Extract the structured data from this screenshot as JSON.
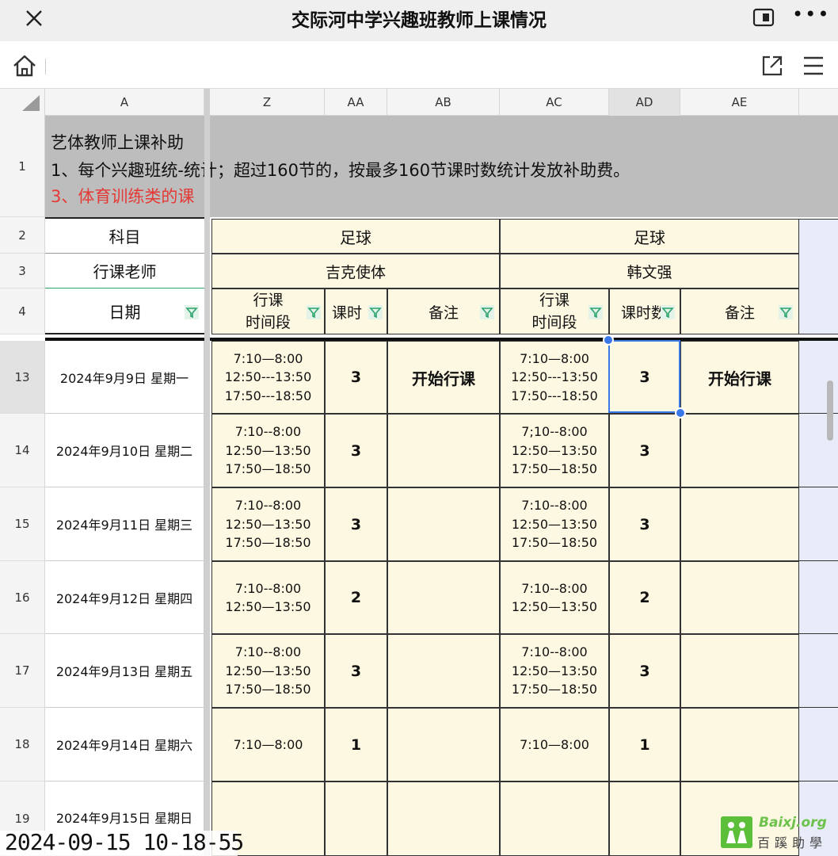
{
  "app": {
    "title": "交际河中学兴趣班教师上课情况"
  },
  "toolbar": {},
  "columns": [
    "A",
    "Z",
    "AA",
    "AB",
    "AC",
    "AD",
    "AE"
  ],
  "row_numbers": [
    "1",
    "2",
    "3",
    "4",
    "13",
    "14",
    "15",
    "16",
    "17",
    "18",
    "19"
  ],
  "notes": {
    "line1": "艺体教师上课补助",
    "line2": "1、每个兴趣班统-统计；超过160节的，按最多160节课时数统计发放补助费。",
    "line3": "3、体育训练类的课"
  },
  "headers": {
    "subject_label": "科目",
    "teacher_label": "行课老师",
    "date_label": "日期",
    "subject1": "足球",
    "subject2": "足球",
    "teacher1": "吉克使体",
    "teacher2": "韩文强",
    "period_label": "行课\n时间段",
    "hours_label": "课时",
    "hours_label_clipped": "课时数",
    "remark_label": "备注"
  },
  "rows": [
    {
      "date": "2024年9月9日 星期一",
      "time1": "7:10—8:00\n12:50---13:50\n17:50---18:50",
      "h1": "3",
      "n1": "开始行课",
      "time2": "7:10—8:00\n12:50---13:50\n17:50---18:50",
      "h2": "3",
      "n2": "开始行课"
    },
    {
      "date": "2024年9月10日 星期二",
      "time1": "7:10--8:00\n12:50—13:50\n17:50—18:50",
      "h1": "3",
      "n1": "",
      "time2": "7;10--8:00\n12:50—13:50\n17:50—18:50",
      "h2": "3",
      "n2": ""
    },
    {
      "date": "2024年9月11日 星期三",
      "time1": "7:10--8:00\n12:50—13:50\n17:50—18:50",
      "h1": "3",
      "n1": "",
      "time2": "7:10--8:00\n12:50—13:50\n17:50—18:50",
      "h2": "3",
      "n2": ""
    },
    {
      "date": "2024年9月12日 星期四",
      "time1": "7:10--8:00\n12:50—13:50",
      "h1": "2",
      "n1": "",
      "time2": "7:10--8:00\n12:50—13:50",
      "h2": "2",
      "n2": ""
    },
    {
      "date": "2024年9月13日 星期五",
      "time1": "7:10--8:00\n12:50—13:50\n17:50—18:50",
      "h1": "3",
      "n1": "",
      "time2": "7:10--8:00\n12:50—13:50\n17:50—18:50",
      "h2": "3",
      "n2": ""
    },
    {
      "date": "2024年9月14日 星期六",
      "time1": "7:10—8:00",
      "h1": "1",
      "n1": "",
      "time2": "7:10—8:00",
      "h2": "1",
      "n2": ""
    },
    {
      "date": "2024年9月15日 星期日",
      "time1": "",
      "h1": "",
      "n1": "",
      "time2": "",
      "h2": "",
      "n2": ""
    }
  ],
  "timestamp": "2024-09-15  10-18-55",
  "watermark": {
    "url": "Baixj.org",
    "name": "百蹊助學"
  },
  "colors": {
    "selection": "#3b78e7",
    "header_fill": "#fdf8e1",
    "red_text": "#e53935"
  }
}
